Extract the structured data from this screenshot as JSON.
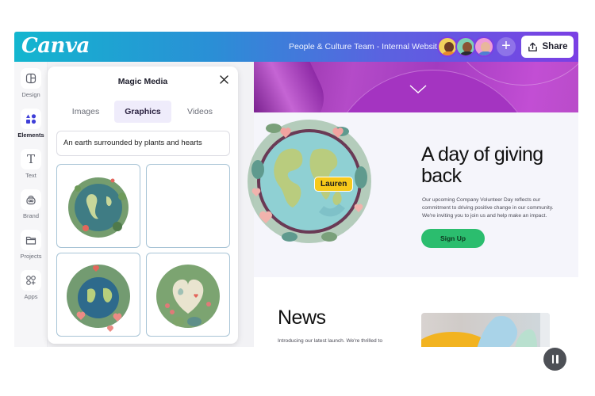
{
  "header": {
    "logo": "Canva",
    "document_title": "People & Culture Team - Internal Website",
    "collaborators": [
      {
        "name": "collaborator-1",
        "color": "#e2b24a"
      },
      {
        "name": "collaborator-2",
        "color": "#58c3a0"
      },
      {
        "name": "collaborator-3",
        "color": "#e58bd3"
      }
    ],
    "add_collaborator_label": "+",
    "share_label": "Share"
  },
  "sidebar": {
    "items": [
      {
        "label": "Design",
        "icon": "layout-icon",
        "active": false
      },
      {
        "label": "Elements",
        "icon": "shapes-icon",
        "active": true
      },
      {
        "label": "Text",
        "icon": "text-icon",
        "active": false
      },
      {
        "label": "Brand",
        "icon": "brand-icon",
        "active": false
      },
      {
        "label": "Projects",
        "icon": "folder-icon",
        "active": false
      },
      {
        "label": "Apps",
        "icon": "apps-icon",
        "active": false
      }
    ]
  },
  "panel": {
    "title": "Magic Media",
    "tabs": [
      {
        "label": "Images",
        "active": false
      },
      {
        "label": "Graphics",
        "active": true
      },
      {
        "label": "Videos",
        "active": false
      }
    ],
    "prompt_value": "An earth surrounded by plants and hearts",
    "results": [
      {
        "label": "earth-with-plants-graphic",
        "loaded": true
      },
      {
        "label": "empty-result",
        "loaded": false
      },
      {
        "label": "earth-with-hearts-graphic",
        "loaded": true
      },
      {
        "label": "heart-earth-graphic",
        "loaded": true
      }
    ]
  },
  "canvas": {
    "headline": "A day of giving back",
    "body": "Our upcoming Company Volunteer Day reflects our commitment to driving positive change in our community. We're inviting you to join us and help make an impact.",
    "cta_label": "Sign Up",
    "collaborator_tag": "Lauren",
    "news_title": "News",
    "news_body": "Introducing our latest launch. We're thrilled to"
  },
  "colors": {
    "brand_gradient_start": "#13b6cf",
    "brand_gradient_end": "#7b3fe4",
    "cta_green": "#2bbd6e",
    "tag_yellow": "#f7c91b",
    "hero_purple": "#a434c1"
  }
}
